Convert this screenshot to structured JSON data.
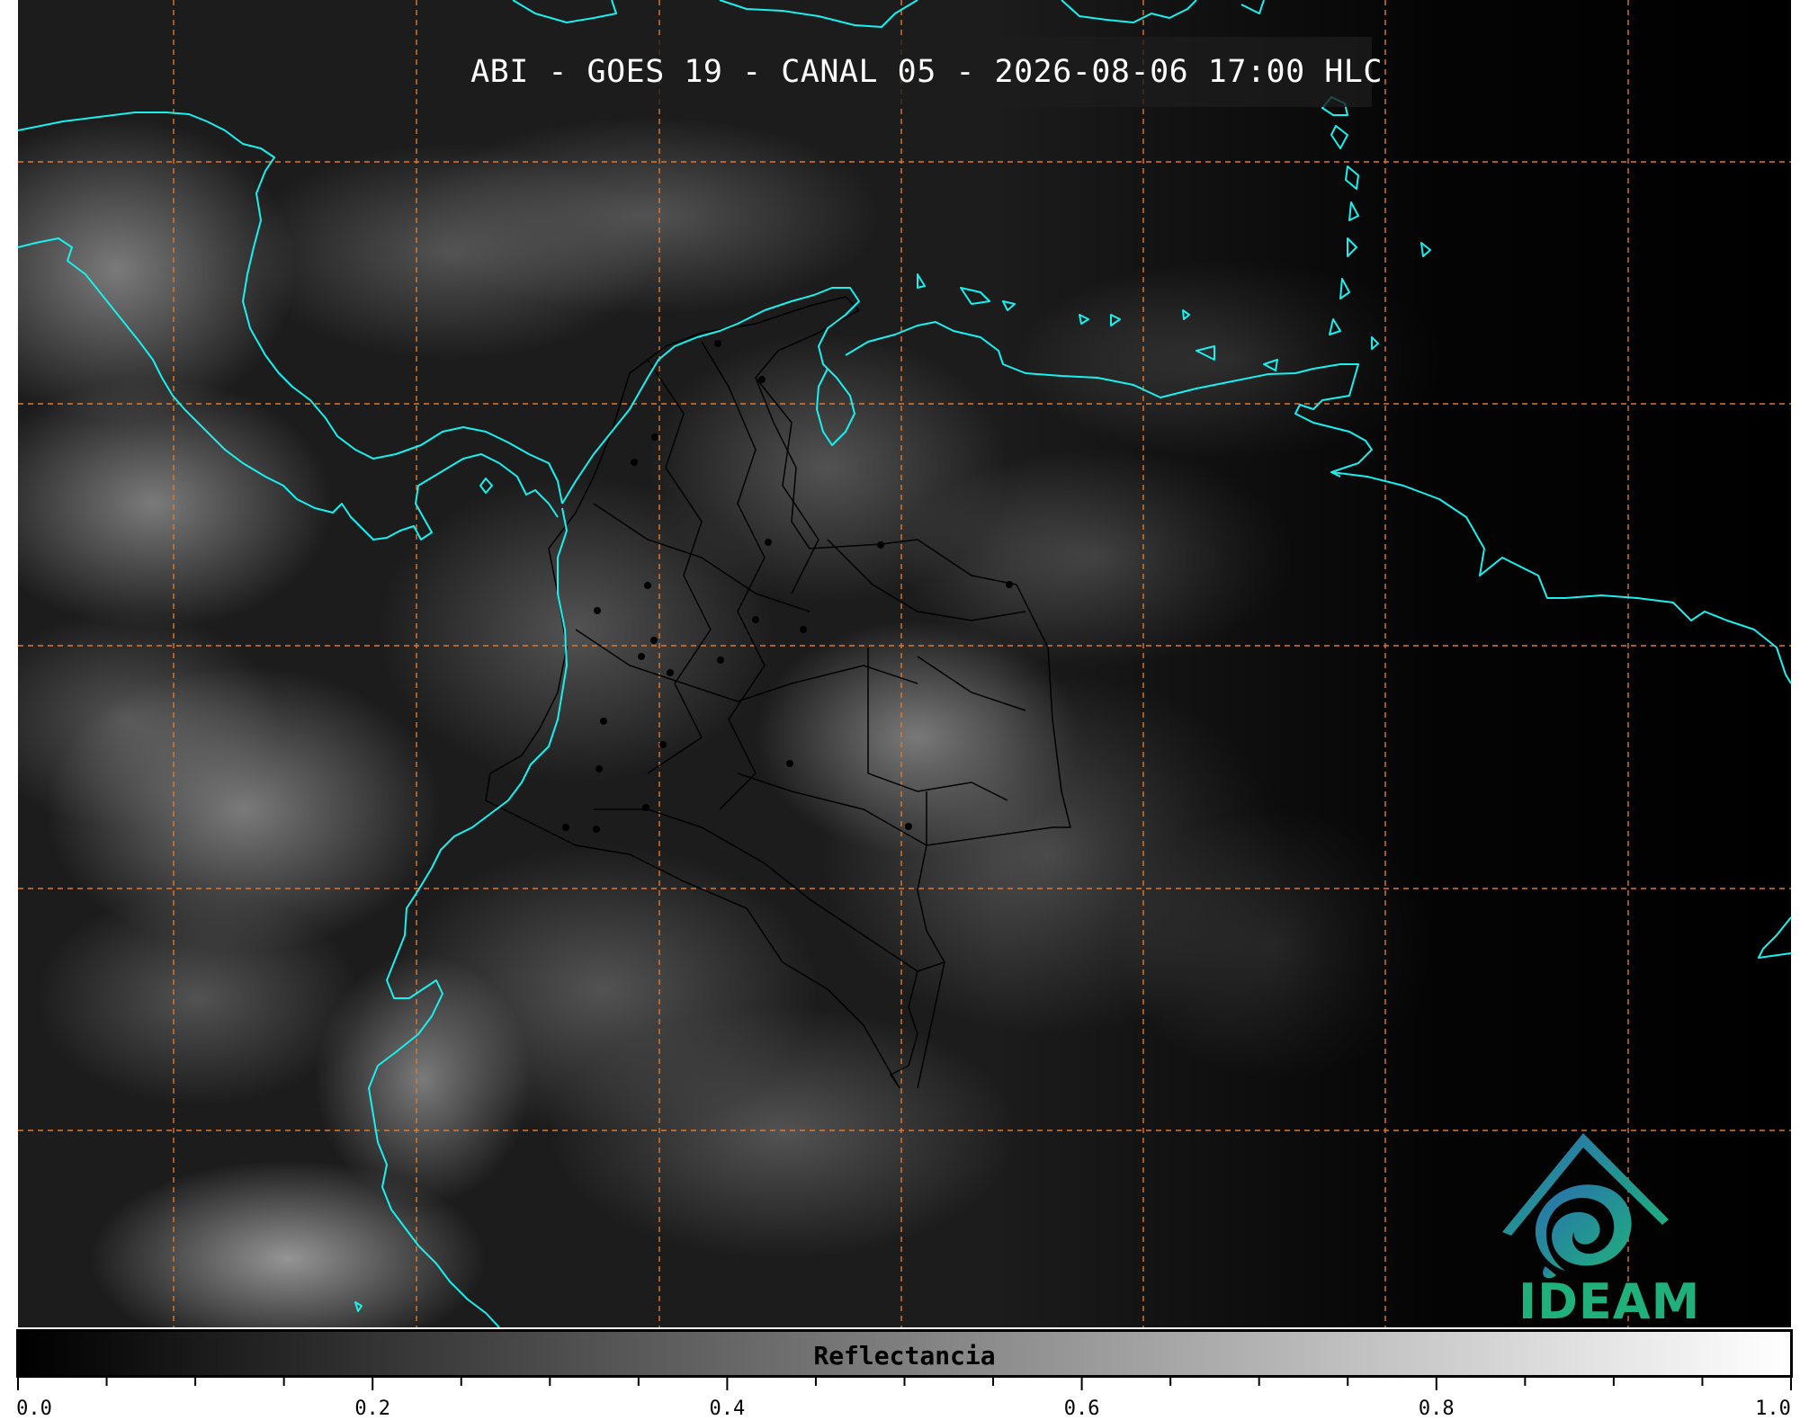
{
  "title": "ABI - GOES 19 - CANAL 05 - 2026-08-06 17:00 HLC",
  "colorbar": {
    "label": "Reflectancia",
    "tick_labels": [
      "0.0",
      "0.2",
      "0.4",
      "0.6",
      "0.8",
      "1.0"
    ],
    "range": [
      0.0,
      1.0
    ],
    "colormap": [
      "#000000",
      "#ffffff"
    ]
  },
  "logo": {
    "text": "IDEAM",
    "colors": [
      "#2a6fb0",
      "#1fb07c"
    ]
  },
  "colors": {
    "coastline": "#19f0f0",
    "gridline": "#e0782a",
    "borders": "#000000"
  }
}
